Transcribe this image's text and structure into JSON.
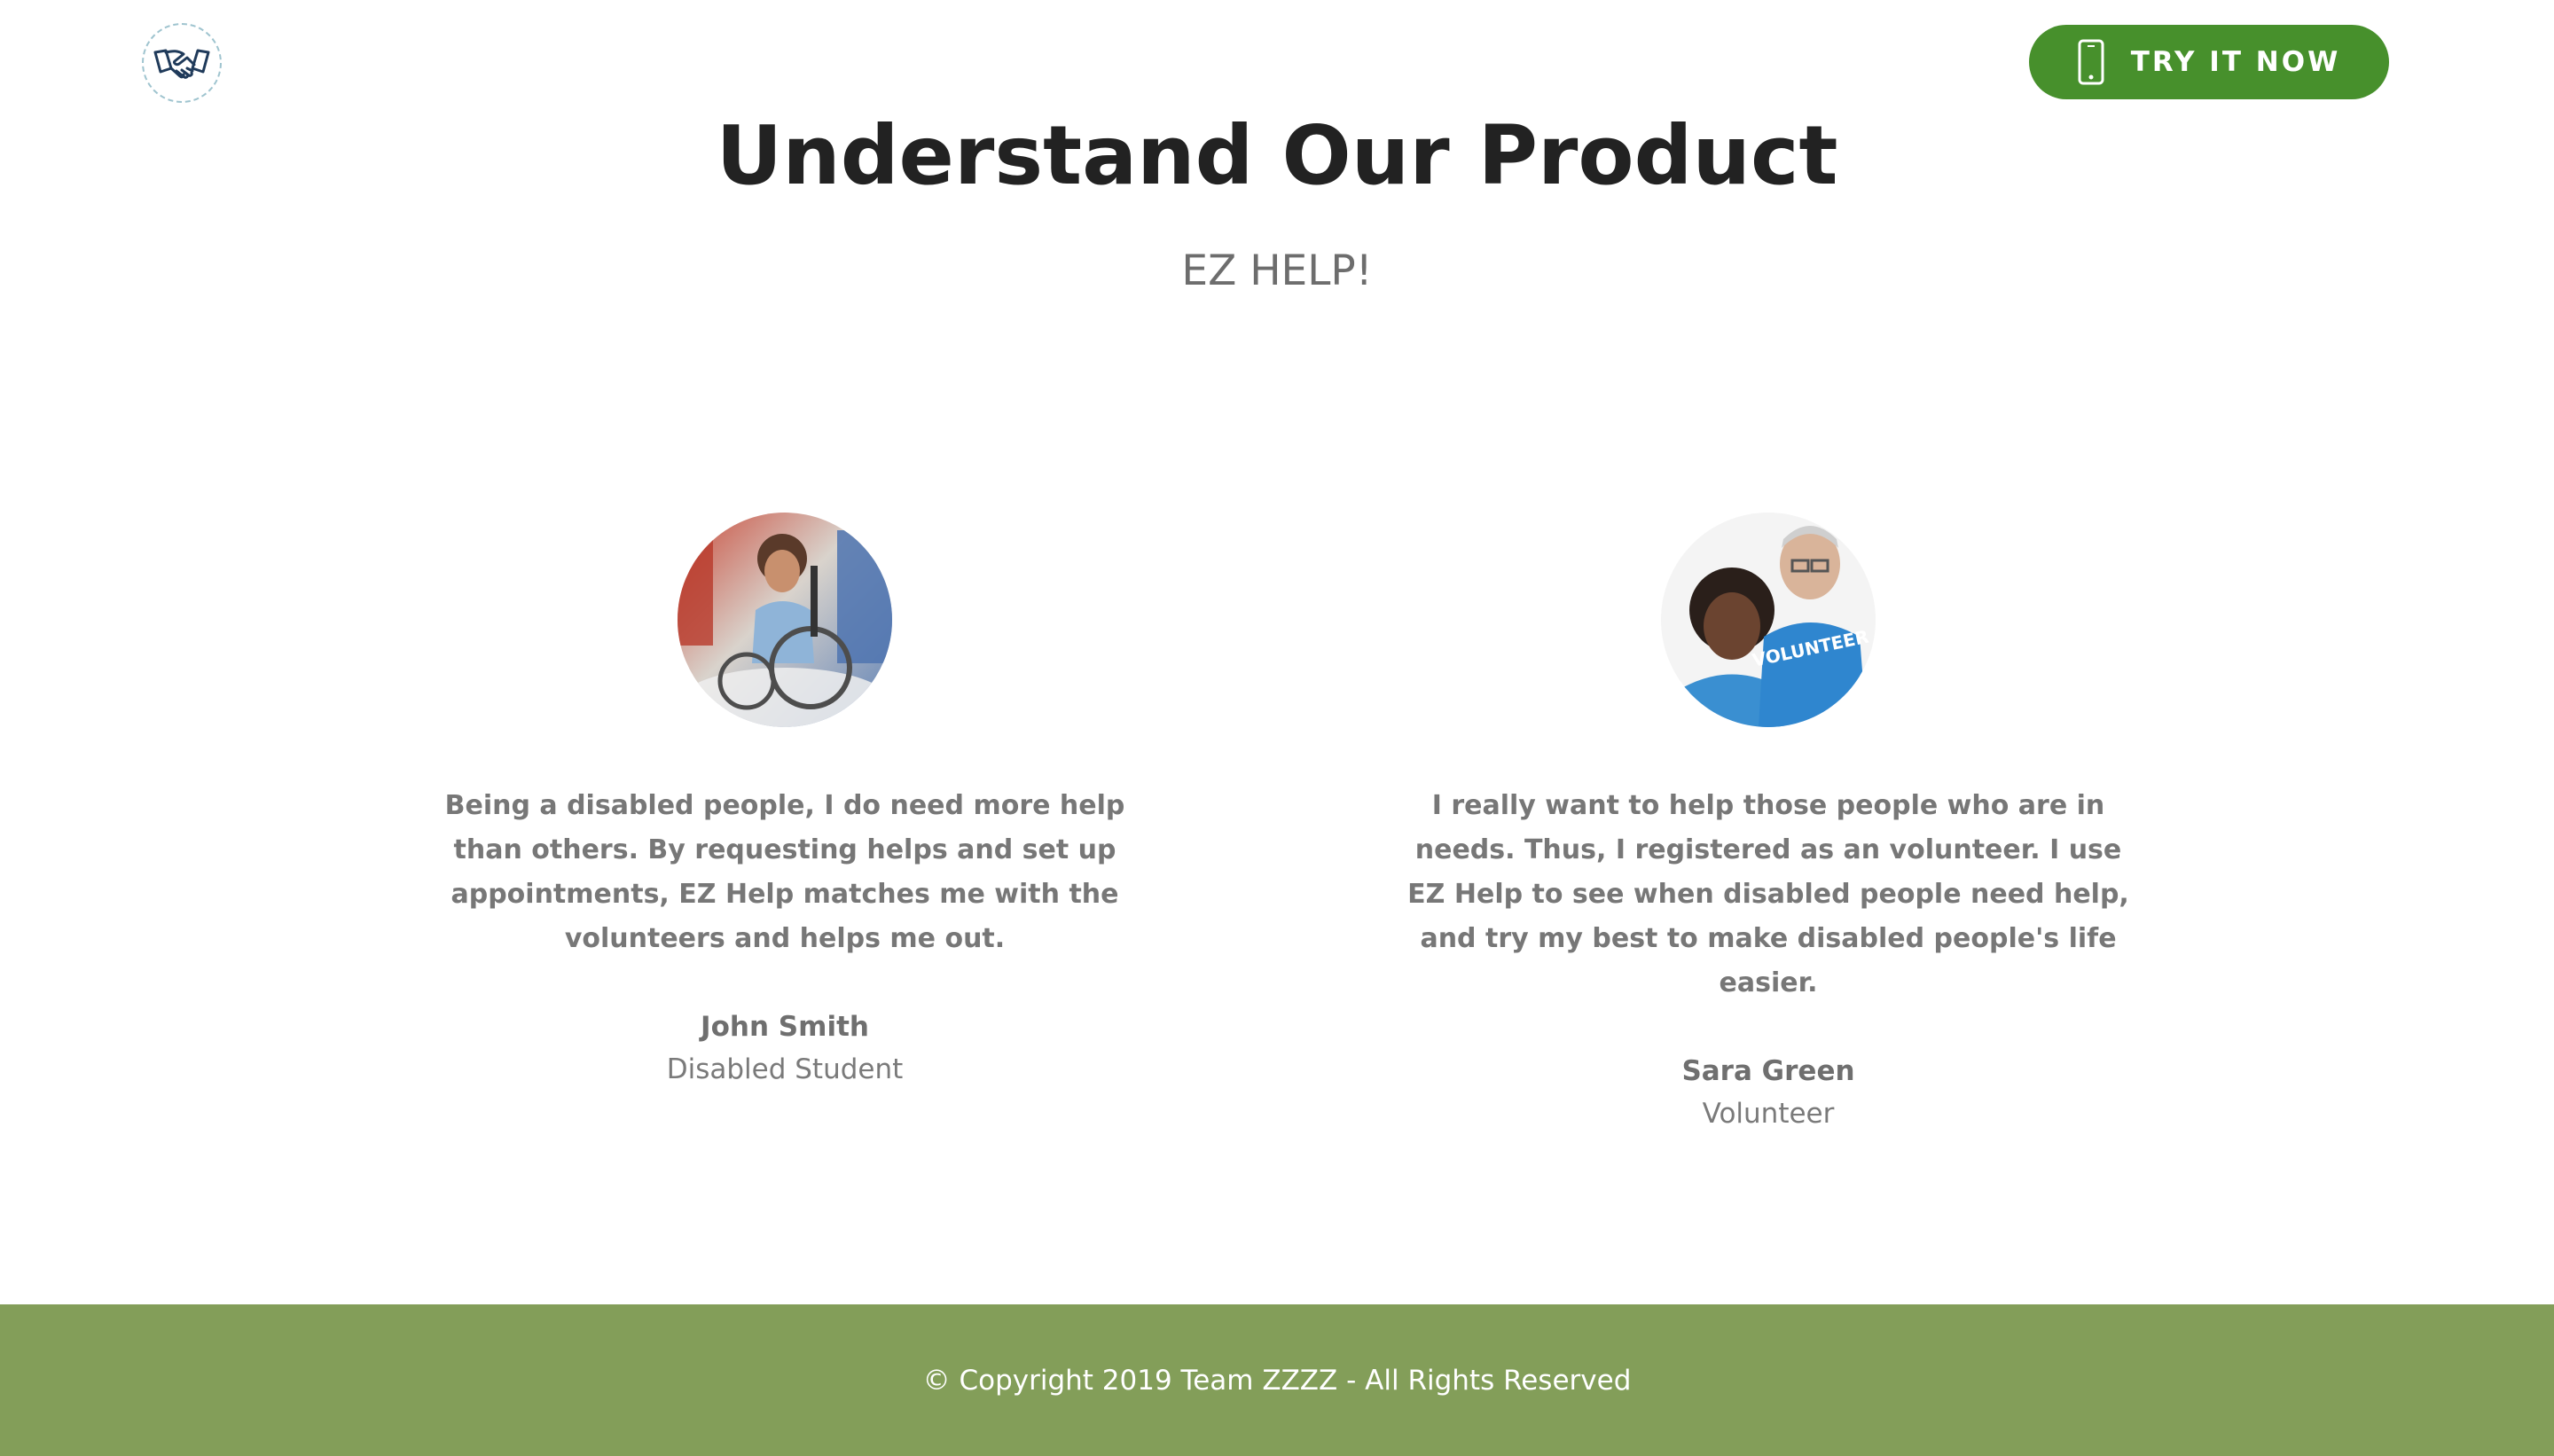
{
  "header": {
    "logo_icon": "handshake-icon",
    "cta_icon": "mobile-phone-icon",
    "cta_label": "TRY IT NOW",
    "cta_color": "#47902c"
  },
  "hero": {
    "title": "Understand Our Product",
    "subtitle": "EZ HELP!"
  },
  "testimonials": [
    {
      "quote": "Being a disabled people, I do need more help than others. By requesting helps and set up appointments, EZ Help matches me with the volunteers and helps me out.",
      "name": "John Smith",
      "role": "Disabled Student"
    },
    {
      "quote": "I really want to help those people who are in needs. Thus, I registered as an volunteer. I use EZ Help to see when disabled people need help, and try my best to make disabled people's life easier.",
      "name": "Sara Green",
      "role": "Volunteer",
      "photo_text": "VOLUNTEER"
    }
  ],
  "footer": {
    "text": "© Copyright 2019 Team ZZZZ - All Rights Reserved",
    "color": "#839e59"
  }
}
